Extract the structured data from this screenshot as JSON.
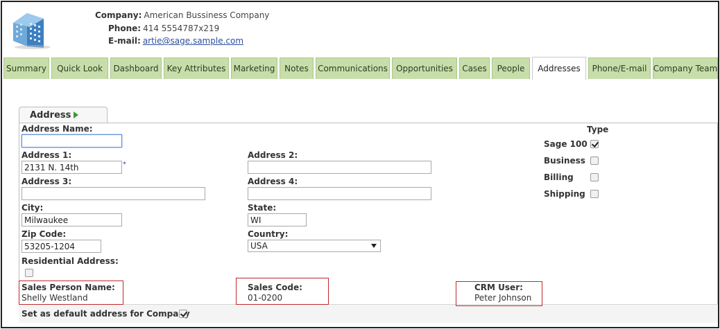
{
  "header": {
    "company_label": "Company:",
    "company_value": "American Bussiness Company",
    "phone_label": "Phone:",
    "phone_value": "414 5554787x219",
    "email_label": "E-mail:",
    "email_value": "artie@sage.sample.com",
    "logo_icon": "building-icon"
  },
  "tabs": [
    {
      "label": "Summary"
    },
    {
      "label": "Quick Look"
    },
    {
      "label": "Dashboard"
    },
    {
      "label": "Key Attributes"
    },
    {
      "label": "Marketing"
    },
    {
      "label": "Notes"
    },
    {
      "label": "Communications"
    },
    {
      "label": "Opportunities"
    },
    {
      "label": "Cases"
    },
    {
      "label": "People"
    },
    {
      "label": "Addresses",
      "active": true
    },
    {
      "label": "Phone/E-mail"
    },
    {
      "label": "Company Team"
    }
  ],
  "panel": {
    "title": "Address",
    "title_icon": "play-arrow-icon"
  },
  "form": {
    "address_name_label": "Address Name:",
    "address_name_value": "",
    "address1_label": "Address 1:",
    "address1_value": "2131 N. 14th",
    "required_mark": "*",
    "address2_label": "Address 2:",
    "address2_value": "",
    "address3_label": "Address 3:",
    "address3_value": "",
    "address4_label": "Address 4:",
    "address4_value": "",
    "city_label": "City:",
    "city_value": "Milwaukee",
    "state_label": "State:",
    "state_value": "WI",
    "zip_label": "Zip Code:",
    "zip_value": "53205-1204",
    "country_label": "Country:",
    "country_value": "USA",
    "residential_label": "Residential Address:",
    "residential_checked": false,
    "sales_person_label": "Sales Person Name:",
    "sales_person_value": "Shelly Westland",
    "sales_code_label": "Sales Code:",
    "sales_code_value": "01-0200",
    "crm_user_label": "CRM User:",
    "crm_user_value": "Peter Johnson",
    "default_address_label": "Set as default address for Company",
    "default_address_checked": true
  },
  "type": {
    "heading": "Type",
    "options": [
      {
        "label": "Sage 100",
        "checked": true
      },
      {
        "label": "Business",
        "checked": false
      },
      {
        "label": "Billing",
        "checked": false
      },
      {
        "label": "Shipping",
        "checked": false
      }
    ]
  },
  "colors": {
    "tab_bg": "#c7deaa",
    "highlight_border": "#c0282d",
    "link": "#2a4f9c"
  }
}
